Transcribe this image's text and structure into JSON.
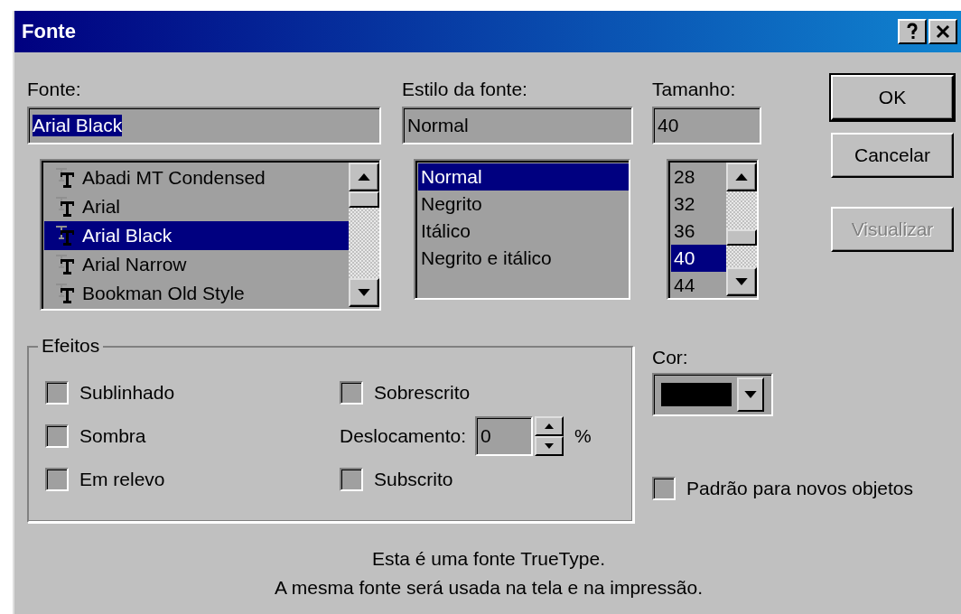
{
  "window": {
    "title": "Fonte",
    "controls": [
      {
        "kind": "help"
      },
      {
        "kind": "close"
      }
    ]
  },
  "font": {
    "label": "Fonte:",
    "value": "Arial Black",
    "value_selected": true,
    "items": [
      {
        "label": "Abadi MT Condensed",
        "selected": false
      },
      {
        "label": "Arial",
        "selected": false
      },
      {
        "label": "Arial Black",
        "selected": true
      },
      {
        "label": "Arial Narrow",
        "selected": false
      },
      {
        "label": "Bookman Old Style",
        "selected": false
      }
    ]
  },
  "style": {
    "label": "Estilo da fonte:",
    "value": "Normal",
    "items": [
      {
        "label": "Normal",
        "selected": true
      },
      {
        "label": "Negrito",
        "selected": false
      },
      {
        "label": "Itálico",
        "selected": false
      },
      {
        "label": "Negrito e itálico",
        "selected": false
      }
    ]
  },
  "size": {
    "label": "Tamanho:",
    "value": "40",
    "items": [
      {
        "label": "28",
        "selected": false
      },
      {
        "label": "32",
        "selected": false
      },
      {
        "label": "36",
        "selected": false
      },
      {
        "label": "40",
        "selected": true
      },
      {
        "label": "44",
        "selected": false
      }
    ]
  },
  "buttons": [
    {
      "label": "OK",
      "disabled": false,
      "default": true
    },
    {
      "label": "Cancelar",
      "disabled": false,
      "default": false
    },
    {
      "label": "Visualizar",
      "disabled": true,
      "default": false
    }
  ],
  "effects": {
    "title": "Efeitos",
    "items": [
      {
        "kind": "checkbox",
        "label": "Sublinhado",
        "checked": false
      },
      {
        "kind": "checkbox",
        "label": "Sobrescrito",
        "checked": false
      },
      {
        "kind": "checkbox",
        "label": "Sombra",
        "checked": false
      },
      {
        "kind": "spinner",
        "label": "Deslocamento:",
        "value": "0",
        "unit": "%"
      },
      {
        "kind": "checkbox",
        "label": "Em relevo",
        "checked": false
      },
      {
        "kind": "checkbox",
        "label": "Subscrito",
        "checked": false
      }
    ]
  },
  "color": {
    "label": "Cor:",
    "color": "#000000"
  },
  "default_checkbox": {
    "label": "Padrão para novos objetos",
    "checked": false
  },
  "note": [
    "Esta é uma fonte TrueType.",
    "A mesma fonte será usada na tela e na impressão."
  ]
}
